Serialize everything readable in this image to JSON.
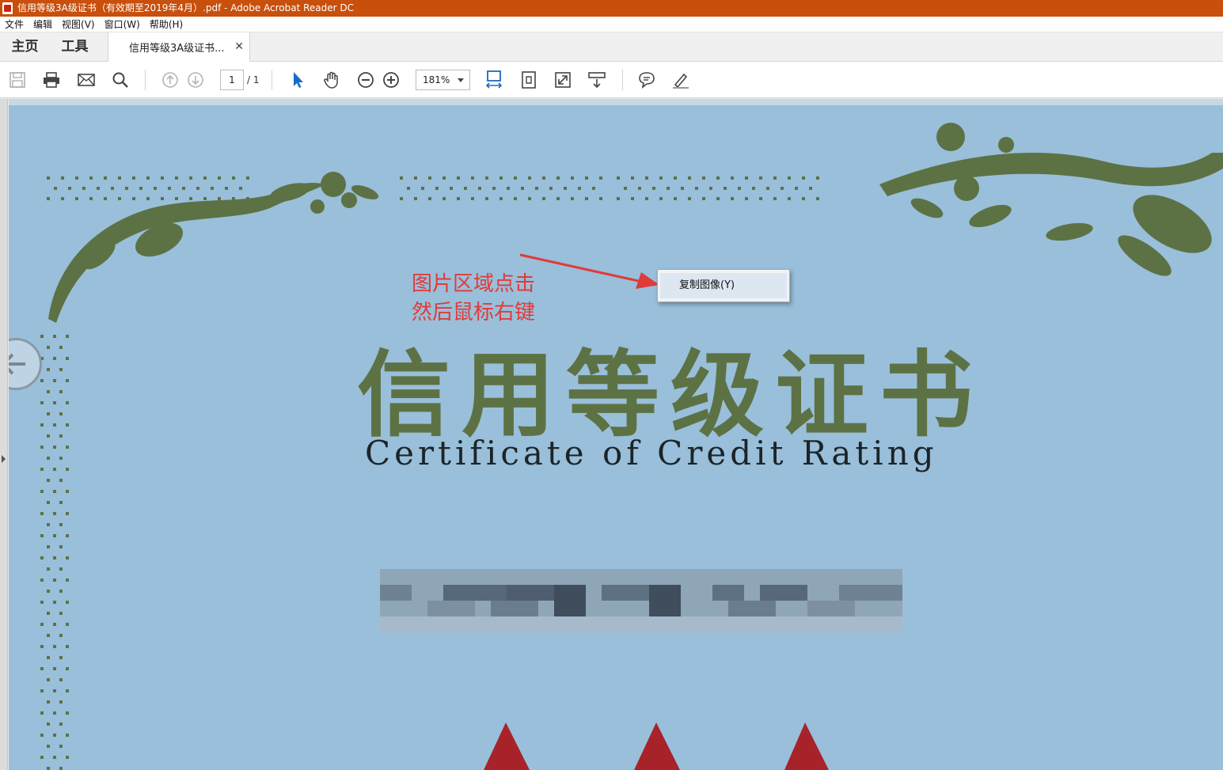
{
  "window": {
    "title": "信用等级3A级证书（有效期至2019年4月）.pdf - Adobe Acrobat Reader DC"
  },
  "menu": {
    "items": [
      "文件",
      "编辑",
      "视图(V)",
      "窗口(W)",
      "帮助(H)"
    ]
  },
  "tabs": {
    "home": "主页",
    "tools": "工具",
    "document": "信用等级3A级证书..."
  },
  "toolbar": {
    "page_current": "1",
    "page_total": "/ 1",
    "zoom": "181%",
    "icons": [
      "save-icon",
      "print-icon",
      "email-icon",
      "search-icon",
      "page-up-icon",
      "page-down-icon",
      "select-arrow-icon",
      "hand-icon",
      "zoom-out-icon",
      "zoom-in-icon",
      "fit-width-icon",
      "fit-page-icon",
      "fullscreen-icon",
      "scroll-mode-icon",
      "comment-icon",
      "highlight-icon"
    ]
  },
  "certificate": {
    "title_cn": "信用等级证书",
    "title_en": "Certificate of Credit Rating"
  },
  "annotation": {
    "line1": "图片区域点击",
    "line2": "然后鼠标右键",
    "color": "#e03a3a"
  },
  "context_menu": {
    "item": "复制图像(Y)"
  },
  "colors": {
    "titlebar": "#c84f0c",
    "certificate_bg": "#99bfda",
    "ornament": "#5d7244"
  }
}
